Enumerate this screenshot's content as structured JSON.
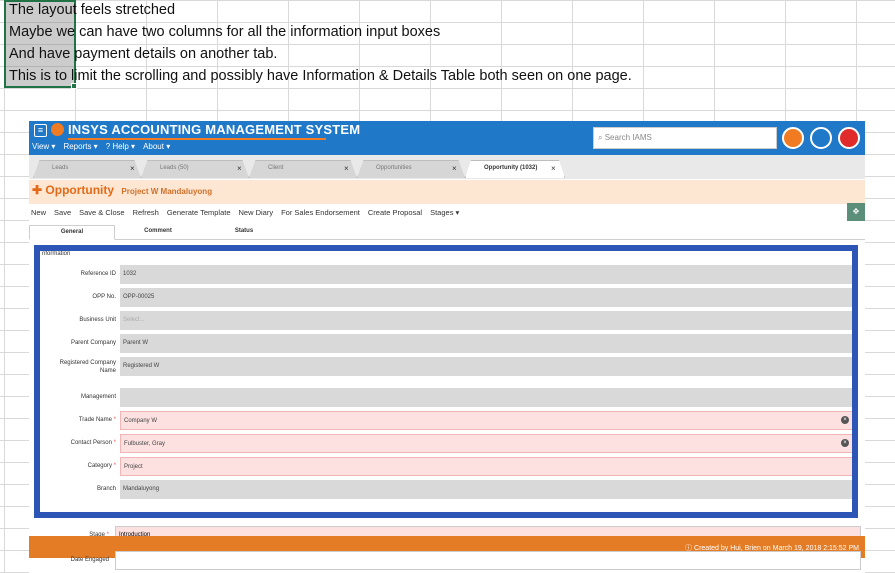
{
  "spreadsheet": {
    "notes": [
      "The layout feels stretched",
      "Maybe we can have two columns for all the information input boxes",
      "And have payment details on another tab.",
      "This is to limit the scrolling and possibly have Information & Details Table both seen on one page."
    ]
  },
  "app": {
    "title": "INSYS ACCOUNTING MANAGEMENT SYSTEM",
    "menu": [
      "View ▾",
      "Reports ▾",
      "? Help ▾",
      "About ▾"
    ],
    "search_placeholder": "Search IAMS",
    "colors": {
      "primary": "#1f78c8",
      "accent": "#f07b22",
      "highlight_border": "#2d55b6"
    }
  },
  "tabs": [
    {
      "label": "Leads",
      "active": false
    },
    {
      "label": "Leads (50)",
      "active": false
    },
    {
      "label": "Client",
      "active": false
    },
    {
      "label": "Opportunities",
      "active": false
    },
    {
      "label": "Opportunity (1032)",
      "active": true
    }
  ],
  "header": {
    "title": "Opportunity",
    "subtitle": "Project W Mandaluyong"
  },
  "toolbar": {
    "new": "New",
    "save": "Save",
    "save_close": "Save & Close",
    "refresh": "Refresh",
    "generate_template": "Generate Template",
    "new_diary": "New Diary",
    "for_sales": "For Sales Endorsement",
    "create_proposal": "Create Proposal",
    "stages": "Stages ▾"
  },
  "subtabs": [
    "General",
    "Comment",
    "Status"
  ],
  "form": {
    "section": "nformation",
    "fields": [
      {
        "label": "Reference ID",
        "value": "1032",
        "required": false
      },
      {
        "label": "OPP No.",
        "value": "OPP-00025",
        "required": false
      },
      {
        "label": "Business Unit",
        "value": "Select...",
        "required": false
      },
      {
        "label": "Parent Company",
        "value": "Parent W",
        "required": false
      },
      {
        "label": "Registered Company Name",
        "value": "Registered W",
        "required": false
      },
      {
        "label": "Management",
        "value": "",
        "required": false
      },
      {
        "label": "Trade Name",
        "value": "Company W",
        "required": true
      },
      {
        "label": "Contact Person",
        "value": "Fulbuster, Gray",
        "required": true
      },
      {
        "label": "Category",
        "value": "Project",
        "required": true
      },
      {
        "label": "Branch",
        "value": "Mandaluyong",
        "required": false
      }
    ],
    "below": [
      {
        "label": "Stage",
        "value": "Introduction"
      },
      {
        "label": "Date Engaged",
        "value": ""
      }
    ]
  },
  "status_bar": {
    "text": "Created by Hui, Brien on March 19, 2018 2:15:52 PM"
  }
}
